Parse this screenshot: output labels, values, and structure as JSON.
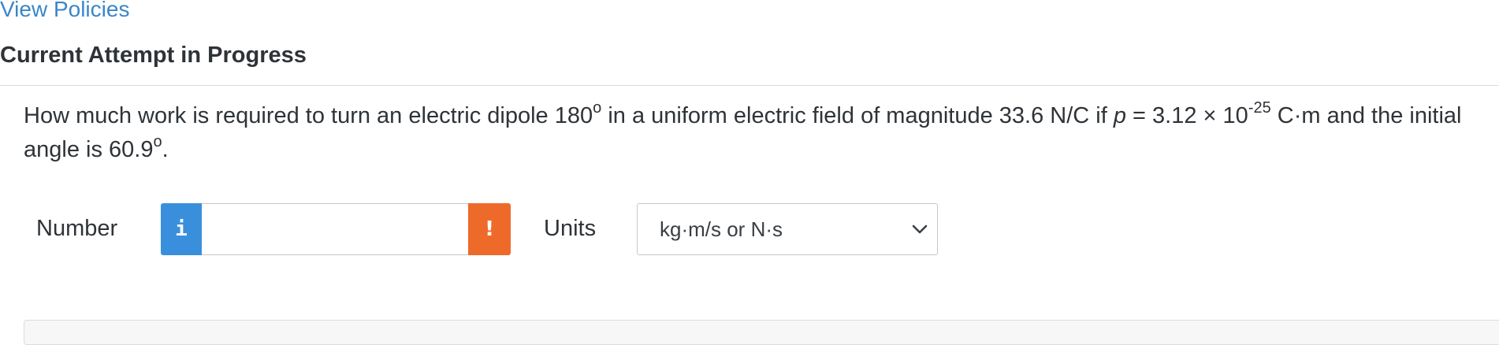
{
  "header": {
    "view_policies_link": "View Policies",
    "attempt_title": "Current Attempt in Progress"
  },
  "question": {
    "part1": "How much work is required to turn an electric dipole 180",
    "deg1": "o",
    "part2": " in a uniform electric field of magnitude 33.6 N/C if ",
    "var_p": "p",
    "part3": " = 3.12 × 10",
    "exponent": "-25",
    "part4": " C·m and the initial angle is 60.9",
    "deg2": "o",
    "part5": "."
  },
  "answer_row": {
    "number_label": "Number",
    "info_button_label": "i",
    "number_value": "",
    "warning_button_label": "!",
    "units_label": "Units",
    "units_selected": "kg·m/s or N·s"
  },
  "colors": {
    "link": "#3a86c8",
    "info_button": "#3a8fdc",
    "warning_button": "#ee6a2b",
    "text": "#2e3338"
  },
  "icons": {
    "info": "info-icon",
    "warning": "exclamation-icon",
    "dropdown": "chevron-down-icon"
  }
}
